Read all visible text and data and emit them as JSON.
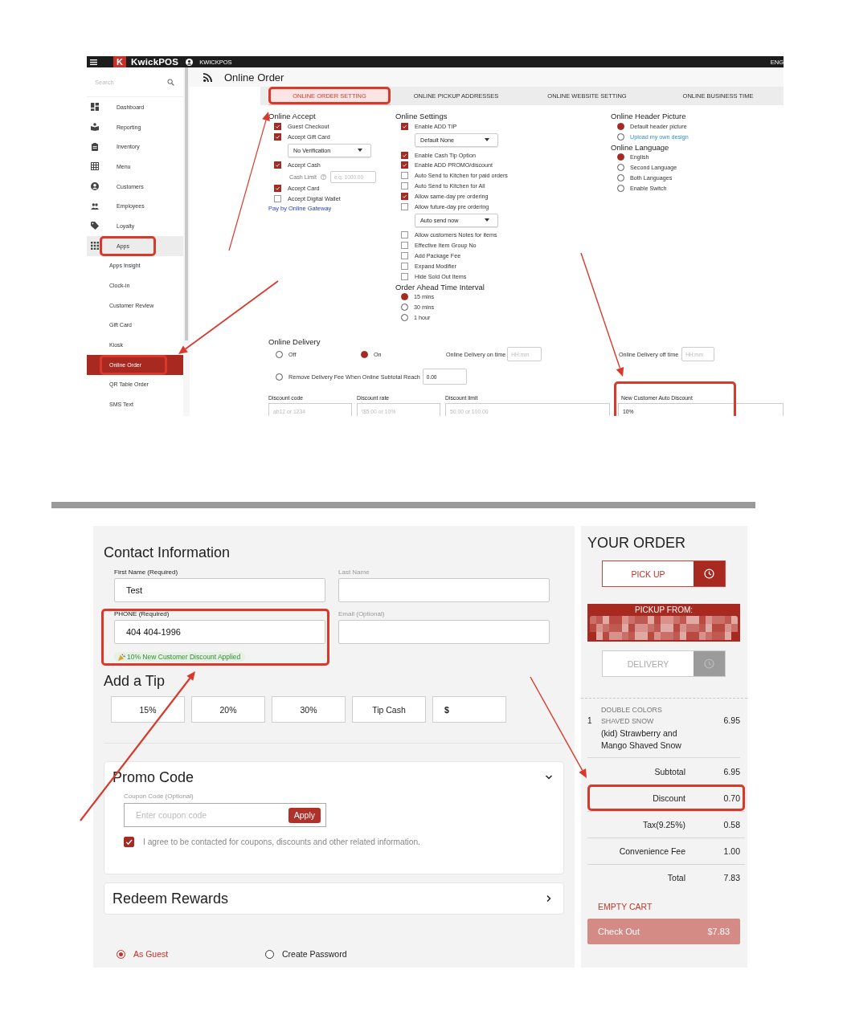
{
  "admin": {
    "topbar": {
      "logo_mark": "K",
      "logo_text": "KwickPOS",
      "account": "KWICKPOS",
      "language": "ENG"
    },
    "sidebar": {
      "search_placeholder": "Search",
      "items": [
        {
          "label": "Dashboard",
          "kind": "main",
          "expanded": false,
          "selected": false,
          "highlighted": false
        },
        {
          "label": "Reporting",
          "kind": "main",
          "expanded": false,
          "selected": false,
          "highlighted": false
        },
        {
          "label": "Inventory",
          "kind": "main",
          "expanded": false,
          "selected": false,
          "highlighted": false
        },
        {
          "label": "Menu",
          "kind": "main",
          "expanded": false,
          "selected": false,
          "highlighted": false
        },
        {
          "label": "Customers",
          "kind": "main",
          "expanded": false,
          "selected": false,
          "highlighted": false
        },
        {
          "label": "Employees",
          "kind": "main",
          "expanded": false,
          "selected": false,
          "highlighted": false
        },
        {
          "label": "Loyalty",
          "kind": "main",
          "expanded": false,
          "selected": false,
          "highlighted": false
        },
        {
          "label": "Apps",
          "kind": "main",
          "expanded": true,
          "selected": false,
          "highlighted": true
        },
        {
          "label": "Apps Insight",
          "kind": "sub",
          "expanded": false,
          "selected": false,
          "highlighted": false
        },
        {
          "label": "Clock-in",
          "kind": "sub",
          "expanded": false,
          "selected": false,
          "highlighted": false
        },
        {
          "label": "Customer Review",
          "kind": "sub",
          "expanded": false,
          "selected": false,
          "highlighted": false
        },
        {
          "label": "Gift Card",
          "kind": "sub",
          "expanded": false,
          "selected": false,
          "highlighted": false
        },
        {
          "label": "Kiosk",
          "kind": "sub",
          "expanded": false,
          "selected": false,
          "highlighted": false
        },
        {
          "label": "Online Order",
          "kind": "sub",
          "expanded": false,
          "selected": true,
          "highlighted": true
        },
        {
          "label": "QR Table Order",
          "kind": "sub",
          "expanded": false,
          "selected": false,
          "highlighted": false
        },
        {
          "label": "SMS Text",
          "kind": "sub",
          "expanded": false,
          "selected": false,
          "highlighted": false
        }
      ]
    },
    "page_title": "Online Order",
    "tabs": [
      {
        "label": "ONLINE ORDER SETTING",
        "selected": true,
        "highlighted": true
      },
      {
        "label": "ONLINE PICKUP ADDRESSES",
        "selected": false,
        "highlighted": false
      },
      {
        "label": "ONLINE WEBSITE SETTING",
        "selected": false,
        "highlighted": false
      },
      {
        "label": "ONLINE BUSINESS TIME",
        "selected": false,
        "highlighted": false
      }
    ],
    "columns": [
      {
        "sections": [
          {
            "heading": "Online Accept",
            "items": [
              {
                "kind": "checkbox",
                "label": "Guest Checkout",
                "checked": true
              },
              {
                "kind": "checkbox",
                "label": "Accept Gift Card",
                "checked": true
              },
              {
                "kind": "select",
                "value": "No Verification"
              },
              {
                "kind": "checkbox",
                "label": "Accept Cash",
                "checked": true
              },
              {
                "kind": "field",
                "label": "Cash Limit",
                "placeholder": "e.g. 1000.00"
              },
              {
                "kind": "checkbox",
                "label": "Accept Card",
                "checked": true
              },
              {
                "kind": "checkbox",
                "label": "Accept Digital Wallet",
                "checked": false
              },
              {
                "kind": "link",
                "label": "Pay by Online Gateway"
              }
            ]
          }
        ]
      },
      {
        "sections": [
          {
            "heading": "Online Settings",
            "items": [
              {
                "kind": "checkbox",
                "label": "Enable ADD TIP",
                "checked": true
              },
              {
                "kind": "select",
                "value": "Default None"
              },
              {
                "kind": "checkbox",
                "label": "Enable Cash Tip Option",
                "checked": true
              },
              {
                "kind": "checkbox",
                "label": "Enable ADD PROMO/discount",
                "checked": true
              },
              {
                "kind": "checkbox",
                "label": "Auto Send to Kitchen for paid orders",
                "checked": false
              },
              {
                "kind": "checkbox",
                "label": "Auto Send to Kitchen for All",
                "checked": false
              },
              {
                "kind": "checkbox",
                "label": "Allow same-day pre ordering",
                "checked": true
              },
              {
                "kind": "checkbox",
                "label": "Allow future-day pre ordering",
                "checked": false
              },
              {
                "kind": "select",
                "value": "Auto send now"
              },
              {
                "kind": "checkbox",
                "label": "Allow customers Notes for items",
                "checked": false
              },
              {
                "kind": "checkbox",
                "label": "Effective Item Group No",
                "checked": false
              },
              {
                "kind": "checkbox",
                "label": "Add Package Fee",
                "checked": false
              },
              {
                "kind": "checkbox",
                "label": "Expand Modifier",
                "checked": false
              },
              {
                "kind": "checkbox",
                "label": "Hide Sold Out Items",
                "checked": false
              }
            ]
          },
          {
            "heading": "Order Ahead Time Interval",
            "items": [
              {
                "kind": "radio",
                "label": "15 mins",
                "selected": true
              },
              {
                "kind": "radio",
                "label": "30 mins",
                "selected": false
              },
              {
                "kind": "radio",
                "label": "1 hour",
                "selected": false
              }
            ]
          }
        ]
      },
      {
        "sections": [
          {
            "heading": "Online Header Picture",
            "items": [
              {
                "kind": "radio",
                "label": "Default header picture",
                "selected": true
              },
              {
                "kind": "radio_link",
                "label": "Upload my own design",
                "selected": false
              }
            ]
          },
          {
            "heading": "Online Language",
            "items": [
              {
                "kind": "radio",
                "label": "English",
                "selected": true
              },
              {
                "kind": "radio",
                "label": "Second Language",
                "selected": false
              },
              {
                "kind": "radio",
                "label": "Both Languages",
                "selected": false
              },
              {
                "kind": "radio",
                "label": "Enable Switch",
                "selected": false
              }
            ]
          }
        ]
      }
    ],
    "delivery": {
      "heading": "Online Delivery",
      "options": [
        {
          "label": "Off",
          "selected": false
        },
        {
          "label": "On",
          "selected": true
        }
      ],
      "on_time": {
        "label": "Online Delivery on time",
        "placeholder": "HH:mm"
      },
      "off_time": {
        "label": "Online Delivery off time",
        "placeholder": "HH:mm"
      },
      "free_delivery": {
        "label": "Remove Delivery Fee When Online Subtotal Reach",
        "selected": false,
        "value": "0.00"
      }
    },
    "discount_fields": [
      {
        "label": "Discount code",
        "placeholder": "ab12 or 1234",
        "highlighted": false
      },
      {
        "label": "Discount rate",
        "placeholder": "\\$5.00 or 10%",
        "highlighted": false
      },
      {
        "label": "Discount limit",
        "placeholder": "50.00 or 100.00",
        "highlighted": false
      },
      {
        "label": "New Customer Auto Discount",
        "value": "10%",
        "highlighted": true
      }
    ]
  },
  "checkout": {
    "contact": {
      "heading": "Contact Information",
      "fields": [
        {
          "label": "First Name (Required)",
          "value": "Test",
          "required": true,
          "highlighted": false
        },
        {
          "label": "Last Name",
          "required": false,
          "highlighted": false
        },
        {
          "label": "PHONE (Required)",
          "value": "404 404-1996",
          "required": true,
          "highlighted": true
        },
        {
          "label": "Email (Optional)",
          "required": false,
          "highlighted": false
        }
      ],
      "discount_notice": "10% New Customer Discount Applied"
    },
    "tip": {
      "heading": "Add a Tip",
      "options": [
        {
          "label": "15%",
          "selected": false
        },
        {
          "label": "20%",
          "selected": false
        },
        {
          "label": "30%",
          "selected": false
        },
        {
          "label": "Tip Cash",
          "selected": false
        }
      ],
      "custom_prefix": "$"
    },
    "promo": {
      "title": "Promo Code",
      "expanded": true,
      "coupon_label": "Coupon Code (Optional)",
      "coupon_placeholder": "Enter coupon code",
      "apply": "Apply",
      "consent": {
        "text": "I agree to be contacted for coupons, discounts and other related information.",
        "checked": true
      }
    },
    "rewards": {
      "title": "Redeem Rewards",
      "expanded": false
    },
    "account_options": [
      {
        "label": "As Guest",
        "selected": true
      },
      {
        "label": "Create Password",
        "selected": false
      }
    ]
  },
  "order": {
    "title": "YOUR ORDER",
    "modes": [
      {
        "label": "PICK UP",
        "selected": true
      },
      {
        "label": "DELIVERY",
        "selected": false
      }
    ],
    "pickup_from": "PICKUP FROM:",
    "items": [
      {
        "qty": "1",
        "name": "DOUBLE COLORS SHAVED SNOW",
        "price": "6.95",
        "description": "(kid) Strawberry and Mango Shaved Snow"
      }
    ],
    "totals": [
      {
        "label": "Subtotal",
        "amount": "6.95",
        "highlighted": false
      },
      {
        "label": "Discount",
        "amount": "0.70",
        "highlighted": true
      },
      {
        "label": "Tax(9.25%)",
        "amount": "0.58",
        "highlighted": false
      },
      {
        "label": "Convenience Fee",
        "amount": "1.00",
        "highlighted": false
      },
      {
        "label": "Total",
        "amount": "7.83",
        "highlighted": false
      }
    ],
    "empty_cart": "EMPTY CART",
    "checkout": {
      "label": "Check Out",
      "amount": "$7.83"
    }
  }
}
